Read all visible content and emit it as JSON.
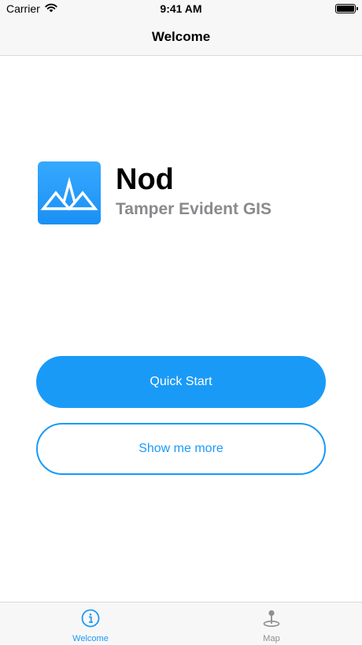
{
  "status_bar": {
    "carrier": "Carrier",
    "time": "9:41 AM",
    "icons": [
      "wifi-icon",
      "battery-icon"
    ]
  },
  "nav": {
    "title": "Welcome"
  },
  "brand": {
    "icon": "nod-logo-icon",
    "name": "Nod",
    "tagline": "Tamper Evident GIS"
  },
  "buttons": {
    "quick_start": "Quick Start",
    "show_more": "Show me more"
  },
  "tabs": [
    {
      "label": "Welcome",
      "icon": "info-icon",
      "active": true
    },
    {
      "label": "Map",
      "icon": "map-pin-icon",
      "active": false
    }
  ],
  "colors": {
    "accent": "#1a9af7",
    "background": "#ffffff",
    "bar": "#f7f7f7",
    "tagline": "#8a8a8e"
  }
}
